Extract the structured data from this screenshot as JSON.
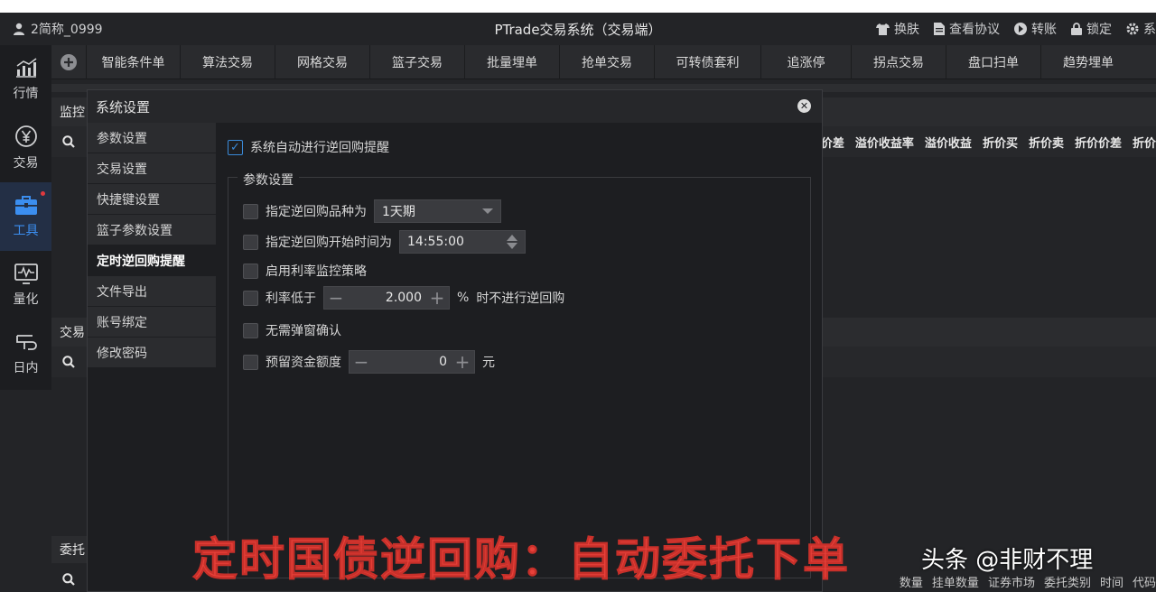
{
  "titlebar": {
    "user": "2简称_0999",
    "title": "PTrade交易系统（交易端）",
    "actions": [
      "换肤",
      "查看协议",
      "转账",
      "锁定",
      "系"
    ]
  },
  "leftnav": {
    "items": [
      {
        "label": "行情",
        "icon": "chart-icon"
      },
      {
        "label": "交易",
        "icon": "yen-icon"
      },
      {
        "label": "工具",
        "icon": "toolbox-icon"
      },
      {
        "label": "量化",
        "icon": "monitor-icon"
      },
      {
        "label": "日内",
        "icon": "intraday-icon"
      }
    ]
  },
  "toolbar": {
    "items": [
      "智能条件单",
      "算法交易",
      "网格交易",
      "篮子交易",
      "批量埋单",
      "抢单交易",
      "可转债套利",
      "追涨停",
      "拐点交易",
      "盘口扫单",
      "趋势埋单"
    ]
  },
  "panels": {
    "monitor": "监控",
    "trade": "交易",
    "order": "委托",
    "columns": [
      "价差",
      "溢价收益率",
      "溢价收益",
      "折价买",
      "折价卖",
      "折价价差",
      "折价"
    ],
    "bottom_columns": [
      "数量",
      "挂单数量",
      "证券市场",
      "委托类别",
      "时间",
      "代码"
    ]
  },
  "dialog": {
    "title": "系统设置",
    "menu": [
      "参数设置",
      "交易设置",
      "快捷键设置",
      "篮子参数设置",
      "定时逆回购提醒",
      "文件导出",
      "账号绑定",
      "修改密码"
    ],
    "active_menu": "定时逆回购提醒",
    "auto_reverse_repo": {
      "label": "系统自动进行逆回购提醒",
      "checked": true
    },
    "group_title": "参数设置",
    "repo_type": {
      "label": "指定逆回购品种为",
      "value": "1天期"
    },
    "start_time": {
      "label": "指定逆回购开始时间为",
      "value": "14:55:00"
    },
    "rate_monitor": {
      "label": "启用利率监控策略"
    },
    "rate_below": {
      "label": "利率低于",
      "value": "2.000",
      "unit": "%",
      "suffix": "时不进行逆回购"
    },
    "no_popup": {
      "label": "无需弹窗确认"
    },
    "reserve": {
      "label": "预留资金额度",
      "value": "0",
      "unit": "元"
    }
  },
  "overlay": {
    "caption": "定时国债逆回购：自动委托下单",
    "watermark": "头条 @非财不理"
  }
}
